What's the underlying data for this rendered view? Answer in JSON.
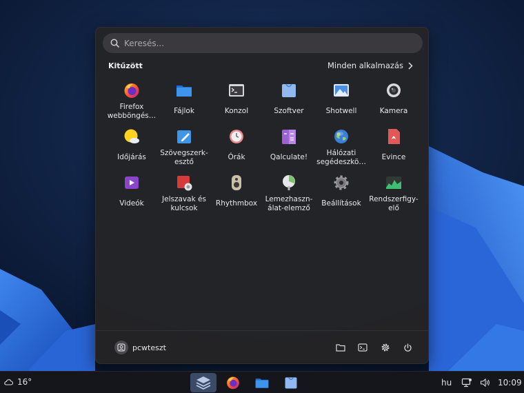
{
  "search": {
    "placeholder": "Keresés..."
  },
  "pinned": {
    "title": "Kitűzött",
    "all_apps_label": "Minden alkalmazás"
  },
  "apps": [
    {
      "label": "Firefox\nwebböngés…",
      "icon": "firefox-icon"
    },
    {
      "label": "Fájlok",
      "icon": "folder-icon"
    },
    {
      "label": "Konzol",
      "icon": "terminal-icon"
    },
    {
      "label": "Szoftver",
      "icon": "software-bag-icon"
    },
    {
      "label": "Shotwell",
      "icon": "photo-icon"
    },
    {
      "label": "Kamera",
      "icon": "camera-icon"
    },
    {
      "label": "Időjárás",
      "icon": "weather-sun-icon"
    },
    {
      "label": "Szövegszerk-\nesztő",
      "icon": "text-editor-icon"
    },
    {
      "label": "Órák",
      "icon": "clock-icon"
    },
    {
      "label": "Qalculate!",
      "icon": "calculator-icon"
    },
    {
      "label": "Hálózati\nsegédeszkö…",
      "icon": "network-globe-icon"
    },
    {
      "label": "Evince",
      "icon": "pdf-document-icon"
    },
    {
      "label": "Videók",
      "icon": "video-play-icon"
    },
    {
      "label": "Jelszavak és\nkulcsok",
      "icon": "keyring-icon"
    },
    {
      "label": "Rhythmbox",
      "icon": "speaker-icon"
    },
    {
      "label": "Lemezhaszn-\nálat-elemző",
      "icon": "disk-usage-icon"
    },
    {
      "label": "Beállítások",
      "icon": "settings-gear-icon"
    },
    {
      "label": "Rendszerfigy-\nelő",
      "icon": "system-monitor-icon"
    }
  ],
  "user": {
    "name": "pcwteszt"
  },
  "taskbar": {
    "temperature": "16°",
    "language": "hu",
    "time": "10:09"
  },
  "colors": {
    "panel_bg": "#242426",
    "accent": "#3a4a67",
    "taskbar_bg": "#14161b"
  }
}
